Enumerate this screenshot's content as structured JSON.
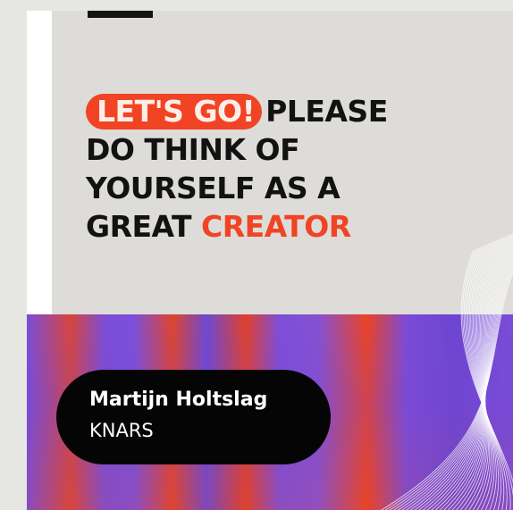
{
  "headline": {
    "tag": "LET'S GO!",
    "line1_rest": "PLEASE",
    "line2": "DO THINK OF",
    "line3": "YOURSELF AS A",
    "line4_start": "GREAT",
    "line4_accent": "CREATOR"
  },
  "speaker": {
    "name": "Martijn Holtslag",
    "organization": "KNARS"
  },
  "colors": {
    "accent": "#f14424",
    "purple": "#7a4dd8",
    "background_beige": "#dddcd8",
    "pill_black": "#050505"
  }
}
